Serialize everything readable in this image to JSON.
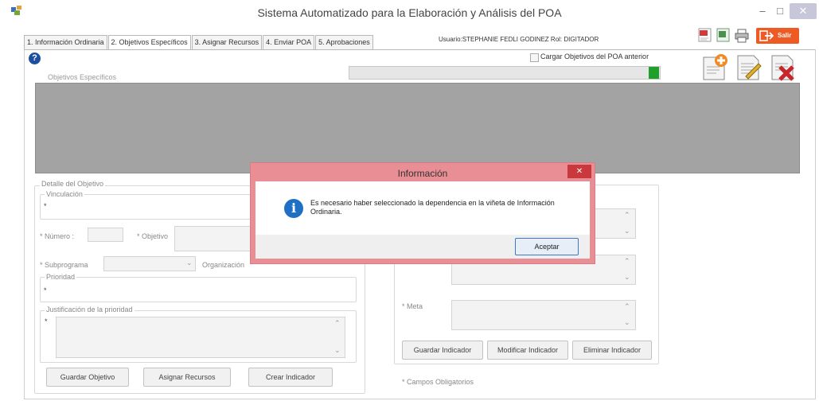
{
  "window": {
    "title": "Sistema Automatizado para la Elaboración y Análisis del POA",
    "minimize": "–",
    "maximize": "□",
    "close": "✕"
  },
  "toolbar": {
    "exit_label": "Salir"
  },
  "tabs": [
    {
      "label": "1. Información Ordinaria"
    },
    {
      "label": "2. Objetivos Específicos"
    },
    {
      "label": "3. Asignar Recursos"
    },
    {
      "label": "4. Enviar POA"
    },
    {
      "label": "5. Aprobaciones"
    }
  ],
  "user_info": "Usuario:STEPHANIE FEDLI GODINEZ  Rol: DIGITADOR",
  "main": {
    "help": "?",
    "cargar_label": "Cargar Objetivos del POA anterior",
    "objetivos_label": "Objetivos Específicos",
    "detalle_legend": "Detalle del Objetivo",
    "vinculacion_label": "Vinculación",
    "vinculacion_value": "*",
    "numero_label": "* Número :",
    "objetivo_label": "* Objetivo",
    "subprograma_label": "* Subprograma",
    "organizacion_label": "Organización",
    "prioridad_label": "Prioridad",
    "prioridad_value": "*",
    "justificacion_label": "Justificación de la prioridad",
    "justificacion_value": "*",
    "btn_guardar_objetivo": "Guardar Objetivo",
    "btn_asignar_recursos": "Asignar Recursos",
    "btn_crear_indicador": "Crear Indicador",
    "meta_label": "* Meta",
    "btn_guardar_indicador": "Guardar Indicador",
    "btn_modificar_indicador": "Modificar Indicador",
    "btn_eliminar_indicador": "Eliminar Indicador",
    "campos_obligatorios": "* Campos Obligatorios"
  },
  "dialog": {
    "title": "Información",
    "close": "✕",
    "message": "Es necesario haber seleccionado la dependencia en la viñeta de Información Ordinaria.",
    "ok_label": "Aceptar"
  },
  "colors": {
    "dialog_frame": "#e88e94",
    "dialog_close": "#c9383d",
    "grid_bg": "#a3a3a3",
    "progress_fill": "#1fa02a",
    "exit_button": "#ee5a24"
  }
}
